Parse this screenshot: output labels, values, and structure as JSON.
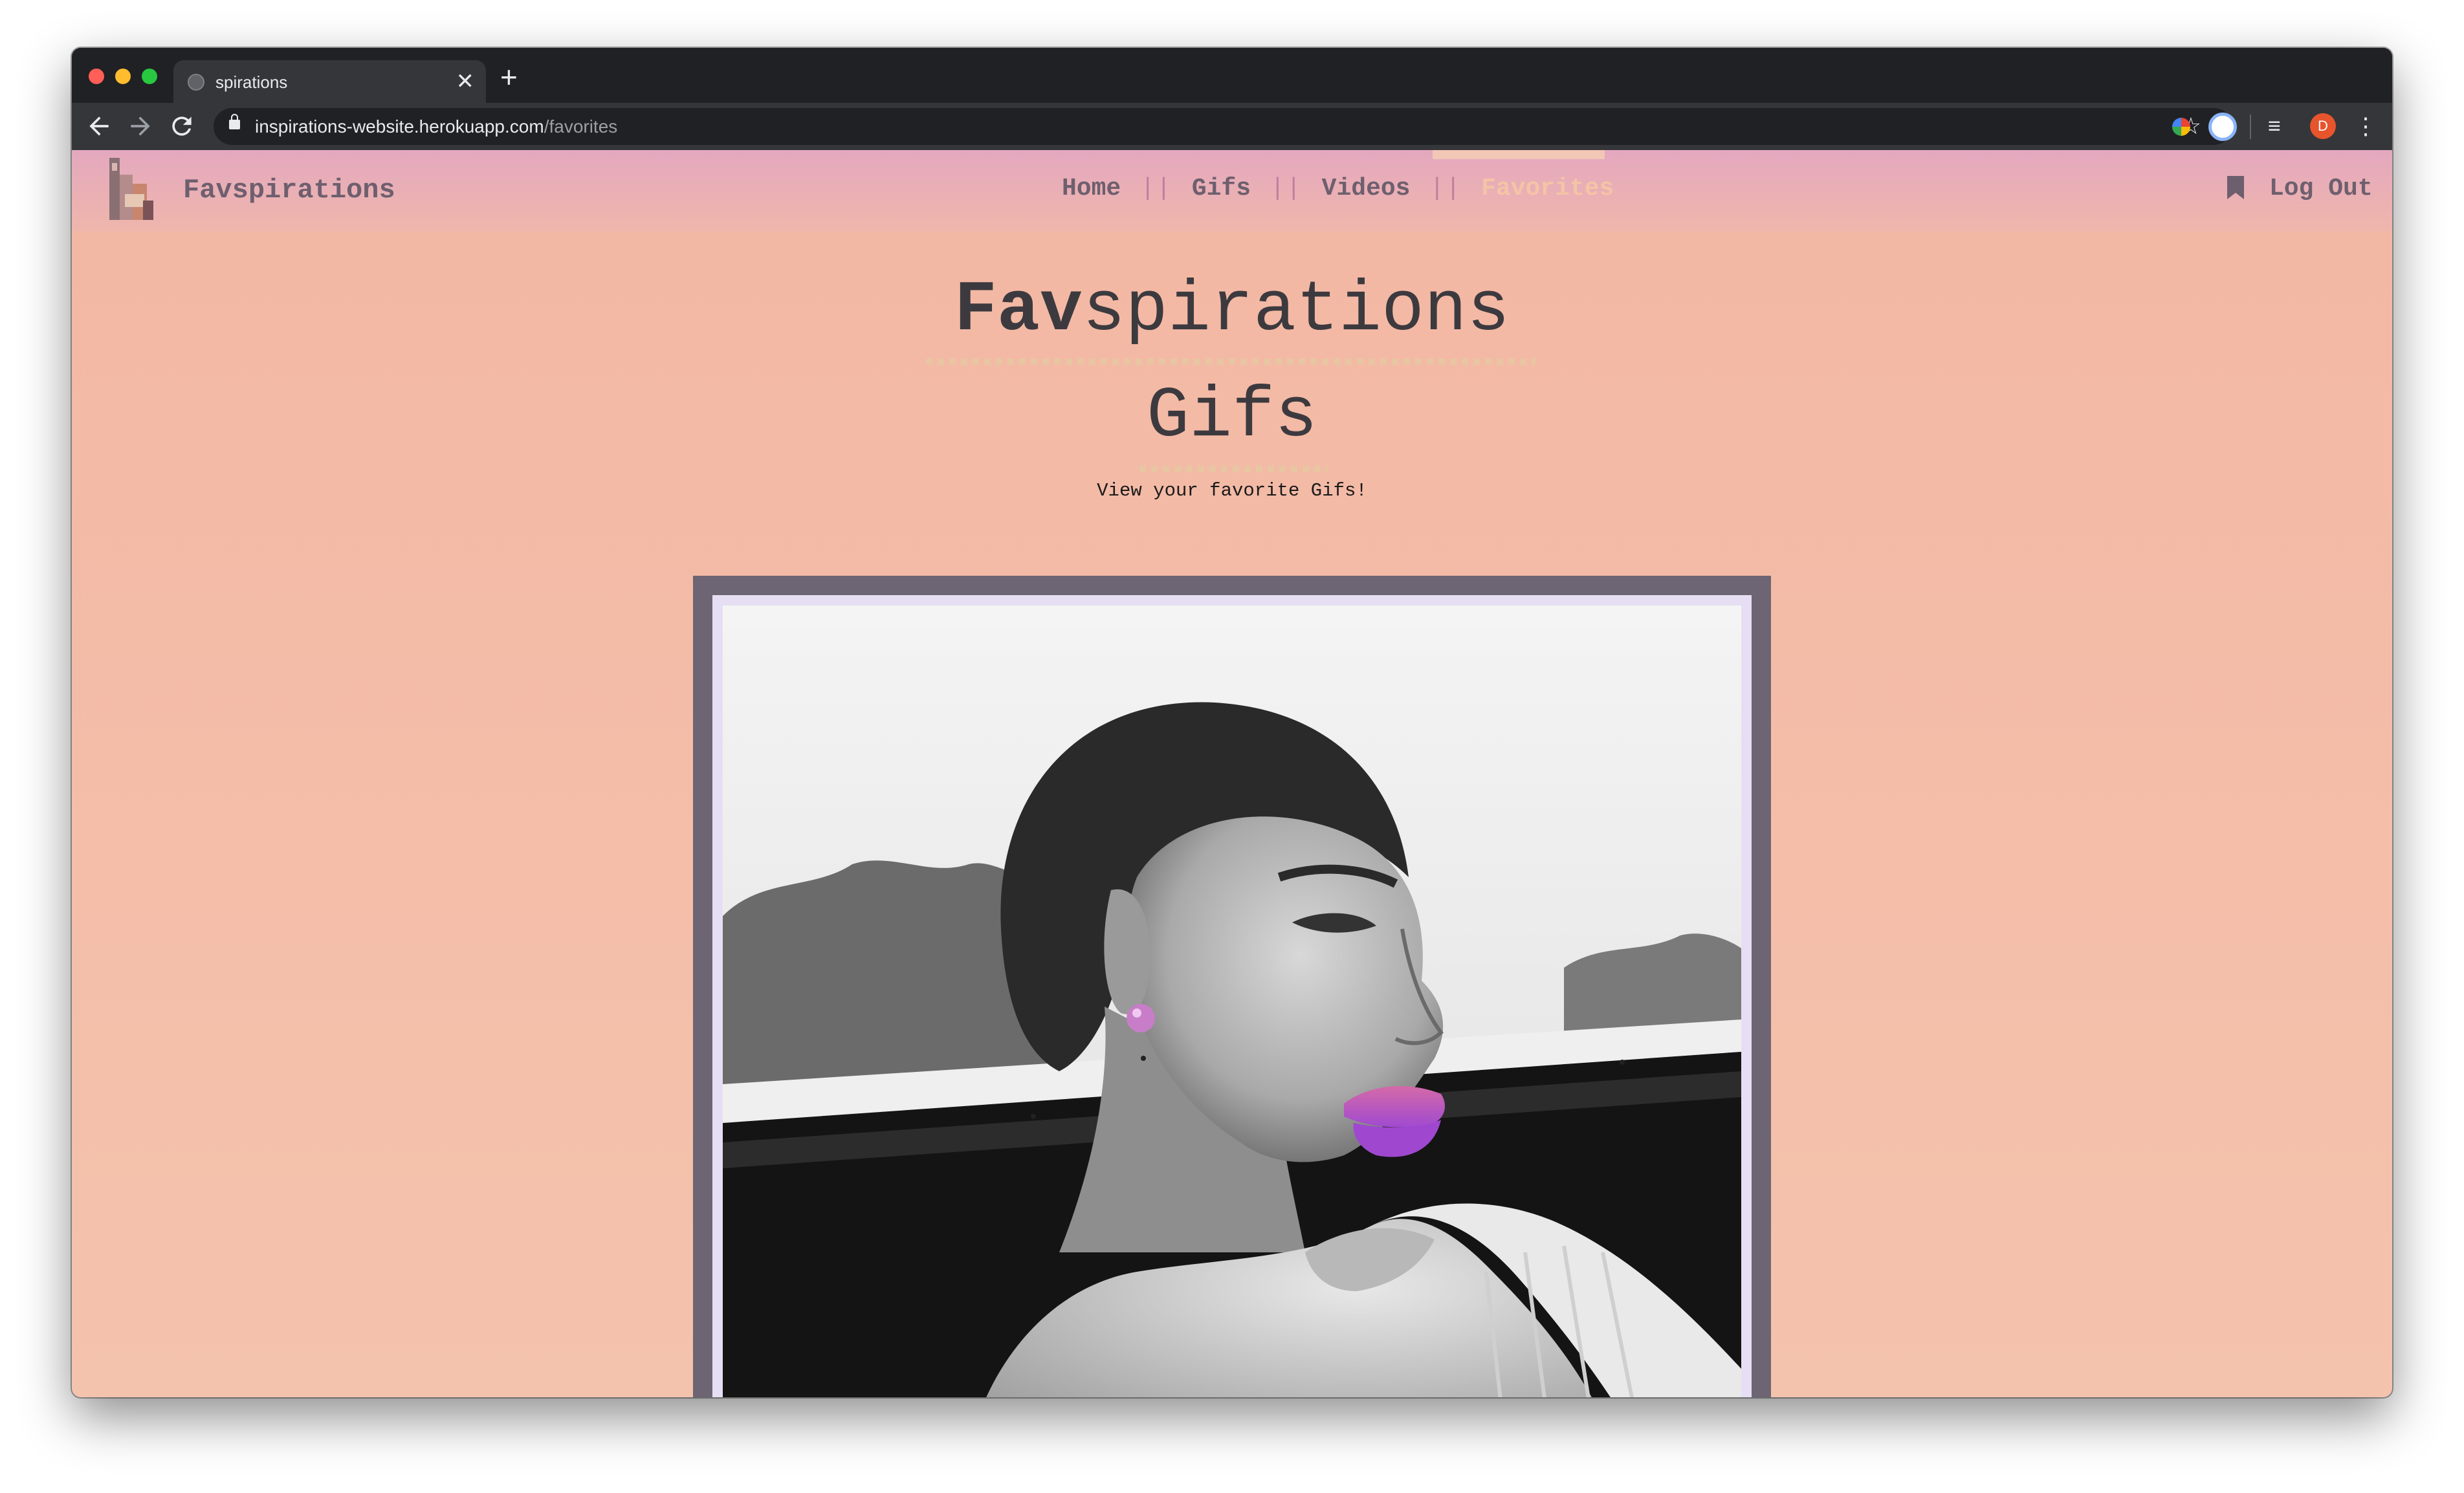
{
  "browser": {
    "tab_title": "spirations",
    "tab_close": "✕",
    "new_tab": "+",
    "url_host": "inspirations-website.herokuapp.com",
    "url_path": "/favorites",
    "avatar_letter": "D",
    "icons": [
      "back-arrow-icon",
      "forward-arrow-icon",
      "reload-icon",
      "lock-icon",
      "star-icon",
      "color-extension-icon",
      "blue-extension-icon",
      "queue-icon",
      "more-vert-icon"
    ]
  },
  "navbar": {
    "brand": "Favspirations",
    "links": [
      {
        "label": "Home"
      },
      {
        "label": "Gifs"
      },
      {
        "label": "Videos"
      },
      {
        "label": "Favorites",
        "active": true
      }
    ],
    "separator": "||",
    "logout": "Log Out"
  },
  "main": {
    "title_bold": "Fav",
    "title_rest": "spirations",
    "subtitle_heading": "Gifs",
    "description": "View your favorite Gifs!"
  },
  "colors": {
    "page_bg": "#f3bca7",
    "navbar_top": "#e4a8bf",
    "active_link": "#f4c4a6",
    "card_border": "#6d6573",
    "card_inner": "#e6def2"
  }
}
